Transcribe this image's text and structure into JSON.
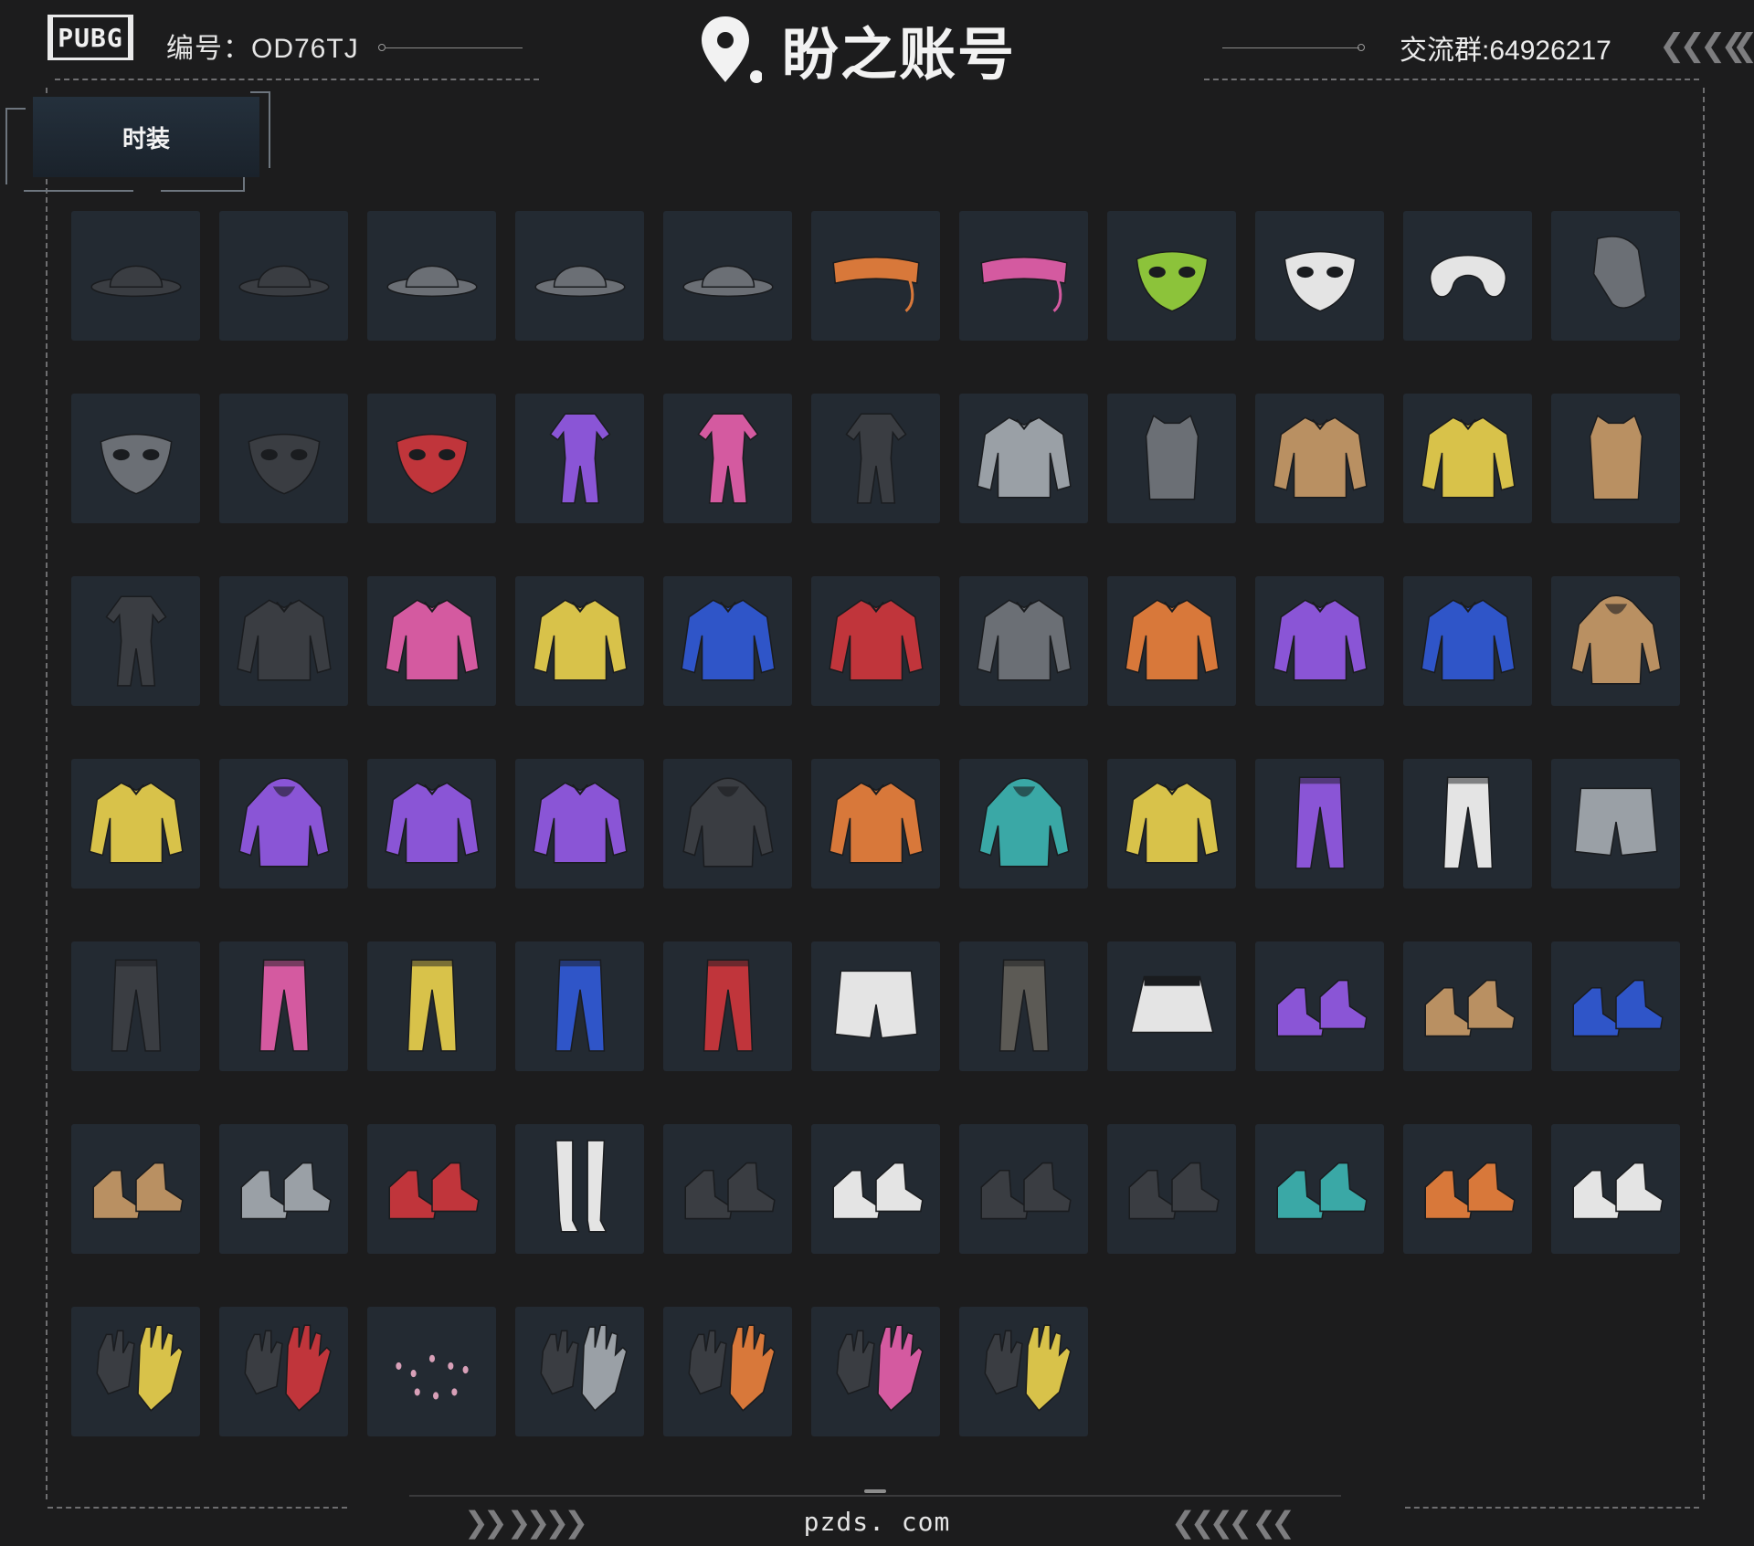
{
  "header": {
    "logo": "PUBG",
    "serial": "编号：OD76TJ",
    "brand": "盼之账号",
    "group": "交流群:64926217",
    "accent": "#eaeaea",
    "panel_color": "#232a32"
  },
  "tabs": [
    {
      "label": "时装",
      "selected": true
    }
  ],
  "items": [
    {
      "icon": "baseball-cap-black-icon"
    },
    {
      "icon": "fedora-hat-icon"
    },
    {
      "icon": "baseball-cap-logo-icon"
    },
    {
      "icon": "bucket-hat-icon"
    },
    {
      "icon": "ice-cream-cone-hat-icon"
    },
    {
      "icon": "visor-glasses-orange-icon"
    },
    {
      "icon": "cyber-visor-pink-icon"
    },
    {
      "icon": "alien-mask-green-icon"
    },
    {
      "icon": "kitsune-fox-mask-icon"
    },
    {
      "icon": "neck-pillow-icon"
    },
    {
      "icon": "hood-scarf-icon"
    },
    {
      "icon": "smile-face-mask-icon"
    },
    {
      "icon": "tactical-mask-icon"
    },
    {
      "icon": "red-demon-mask-icon"
    },
    {
      "icon": "purple-dress-outfit-icon"
    },
    {
      "icon": "pink-suit-outfit-icon"
    },
    {
      "icon": "dark-bodysuit-icon"
    },
    {
      "icon": "grey-tactical-shirt-icon"
    },
    {
      "icon": "sports-crop-top-icon"
    },
    {
      "icon": "white-tang-shirt-icon"
    },
    {
      "icon": "yellow-tee-icon"
    },
    {
      "icon": "bronze-vest-icon"
    },
    {
      "icon": "black-tactical-suit-icon"
    },
    {
      "icon": "black-lanyard-jacket-icon"
    },
    {
      "icon": "pink-jersey-icon"
    },
    {
      "icon": "yellow-jersey-icon"
    },
    {
      "icon": "blue-jersey-icon"
    },
    {
      "icon": "red-jersey-icon"
    },
    {
      "icon": "floral-shirt-icon"
    },
    {
      "icon": "grey-orange-jacket-icon"
    },
    {
      "icon": "purple-varsity-jacket-icon"
    },
    {
      "icon": "navy-sash-sweater-icon"
    },
    {
      "icon": "bear-hood-coat-icon"
    },
    {
      "icon": "yellow-fluffy-sweater-icon"
    },
    {
      "icon": "purple-horn-hoodie-icon"
    },
    {
      "icon": "black-purple-jacket-icon"
    },
    {
      "icon": "purple-racing-jacket-icon"
    },
    {
      "icon": "black-aura-hoodie-icon"
    },
    {
      "icon": "orange-harness-jacket-icon"
    },
    {
      "icon": "teal-ear-hoodie-icon"
    },
    {
      "icon": "yellow-white-jacket-icon"
    },
    {
      "icon": "black-purple-pants-icon"
    },
    {
      "icon": "black-white-chaps-icon"
    },
    {
      "icon": "denim-shorts-icon"
    },
    {
      "icon": "black-cargo-pants-icon"
    },
    {
      "icon": "pink-leggings-icon"
    },
    {
      "icon": "yellow-leggings-icon"
    },
    {
      "icon": "blue-leggings-icon"
    },
    {
      "icon": "red-leggings-icon"
    },
    {
      "icon": "white-shorts-icon"
    },
    {
      "icon": "camo-pants-icon"
    },
    {
      "icon": "white-pleated-skirt-icon"
    },
    {
      "icon": "purple-platform-boots-icon"
    },
    {
      "icon": "tan-desert-boots-icon"
    },
    {
      "icon": "black-blue-sneakers-icon"
    },
    {
      "icon": "tan-work-boots-icon"
    },
    {
      "icon": "grey-running-shoes-icon"
    },
    {
      "icon": "white-red-sneakers-icon"
    },
    {
      "icon": "white-stockings-icon"
    },
    {
      "icon": "black-ankle-boots-icon"
    },
    {
      "icon": "white-black-sneakers-icon"
    },
    {
      "icon": "black-tall-boots-icon"
    },
    {
      "icon": "black-flats-icon"
    },
    {
      "icon": "teal-clogs-icon"
    },
    {
      "icon": "orange-hi-top-sneakers-icon"
    },
    {
      "icon": "white-knee-boots-icon"
    },
    {
      "icon": "yellow-white-gloves-icon"
    },
    {
      "icon": "black-red-moto-gloves-icon"
    },
    {
      "icon": "nail-set-icon"
    },
    {
      "icon": "grey-ring-hand-icon"
    },
    {
      "icon": "black-orange-gloves-icon"
    },
    {
      "icon": "pink-gloves-icon"
    },
    {
      "icon": "black-yellow-gloves-icon"
    }
  ],
  "footer": {
    "site": "pzds. com"
  }
}
